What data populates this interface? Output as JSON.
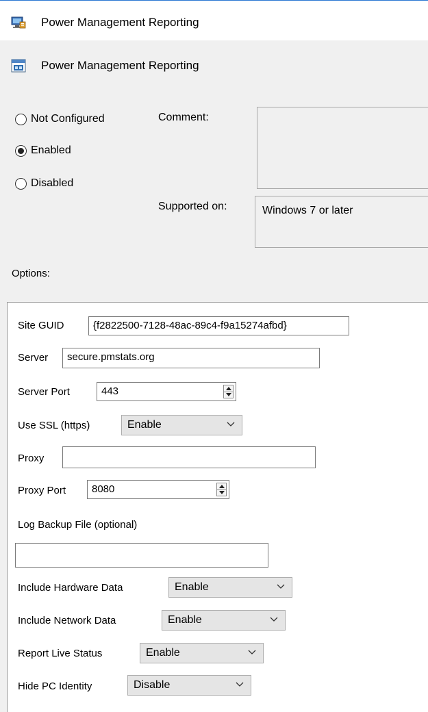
{
  "window": {
    "title": "Power Management Reporting"
  },
  "policy": {
    "name": "Power Management Reporting"
  },
  "state": {
    "not_configured": "Not Configured",
    "enabled": "Enabled",
    "disabled": "Disabled",
    "selected": "enabled"
  },
  "comment": {
    "label": "Comment:",
    "value": ""
  },
  "supported": {
    "label": "Supported on:",
    "value": "Windows 7 or later"
  },
  "options": {
    "label": "Options:",
    "site_guid": {
      "label": "Site GUID",
      "value": "{f2822500-7128-48ac-89c4-f9a15274afbd}"
    },
    "server": {
      "label": "Server",
      "value": "secure.pmstats.org"
    },
    "server_port": {
      "label": "Server Port",
      "value": "443"
    },
    "use_ssl": {
      "label": "Use SSL (https)",
      "value": "Enable"
    },
    "proxy": {
      "label": "Proxy",
      "value": ""
    },
    "proxy_port": {
      "label": "Proxy Port",
      "value": "8080"
    },
    "log_backup": {
      "label": "Log Backup File (optional)",
      "value": ""
    },
    "include_hardware": {
      "label": "Include Hardware Data",
      "value": "Enable"
    },
    "include_network": {
      "label": "Include Network Data",
      "value": "Enable"
    },
    "report_live": {
      "label": "Report Live Status",
      "value": "Enable"
    },
    "hide_pc": {
      "label": "Hide PC Identity",
      "value": "Disable"
    }
  }
}
